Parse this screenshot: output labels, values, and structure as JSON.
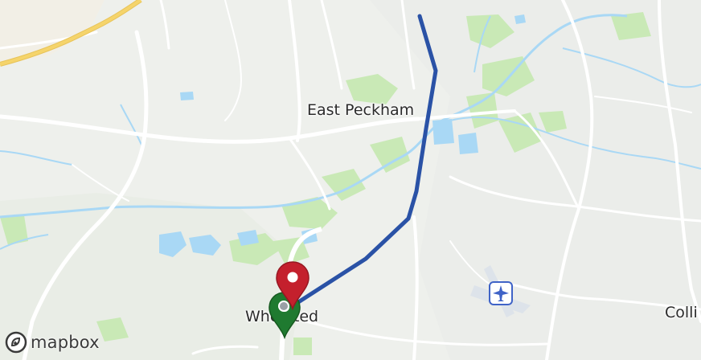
{
  "map": {
    "places": [
      {
        "id": "east-peckham",
        "name": "East Peckham"
      },
      {
        "id": "whetsted",
        "name": "Whetsted"
      },
      {
        "id": "collier",
        "name": "Colli"
      }
    ],
    "attribution": {
      "logo_text": "mapbox"
    },
    "route": {
      "color": "#2a52a6"
    },
    "markers": {
      "start": {
        "color": "#1f7a30",
        "icon": "map-pin-icon"
      },
      "end": {
        "color": "#c4202d",
        "icon": "map-pin-icon"
      }
    },
    "airfield_icon": "airplane-icon",
    "colors": {
      "water": "#a9d8f5",
      "park": "#c5e8b0",
      "background": "#eef0ec",
      "motorway": "#f5d46b",
      "road": "#ffffff"
    }
  }
}
